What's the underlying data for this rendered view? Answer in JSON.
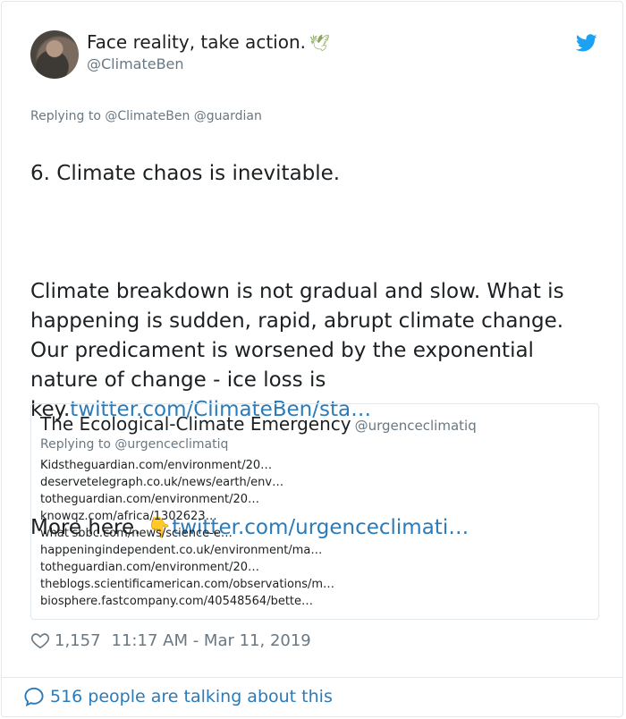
{
  "author": {
    "display_name": "Face reality, take action.",
    "emoji": "🕊",
    "handle": "@ClimateBen"
  },
  "reply_to": "Replying to @ClimateBen @guardian",
  "tweet": {
    "heading": "6. Climate chaos is inevitable.",
    "body": "Climate breakdown is not gradual and slow. What is happening is sudden, rapid, abrupt climate change. Our predicament is worsened by the exponential nature of change - ice loss is key.",
    "body_link": "twitter.com/ClimateBen/sta…",
    "more_prefix": "More here.",
    "more_emoji": "👇",
    "more_link": "twitter.com/urgenceclimati…"
  },
  "quote": {
    "name": "The Ecological-Climate Emergency",
    "handle": "@urgenceclimatiq",
    "reply_to": "Replying to @urgenceclimatiq",
    "lines": [
      "Kidstheguardian.com/environment/20…",
      "deservetelegraph.co.uk/news/earth/env…",
      "totheguardian.com/environment/20…",
      "knowqz.com/africa/1302623…",
      "what'sbbc.com/news/science-e…",
      "happeningindependent.co.uk/environment/ma…",
      "totheguardian.com/environment/20…",
      "theblogs.scientificamerican.com/observations/m…",
      "biosphere.fastcompany.com/40548564/bette…"
    ]
  },
  "meta": {
    "likes": "1,157",
    "timestamp": "11:17 AM - Mar 11, 2019"
  },
  "talk": "516 people are talking about this",
  "colors": {
    "link": "#2b7bb9",
    "muted": "#697882",
    "border": "#e1e8ed",
    "twitter_blue": "#1da1f2"
  },
  "icons": {
    "logo": "twitter-bird-icon",
    "like": "heart-outline-icon",
    "talk": "speech-bubble-icon"
  }
}
